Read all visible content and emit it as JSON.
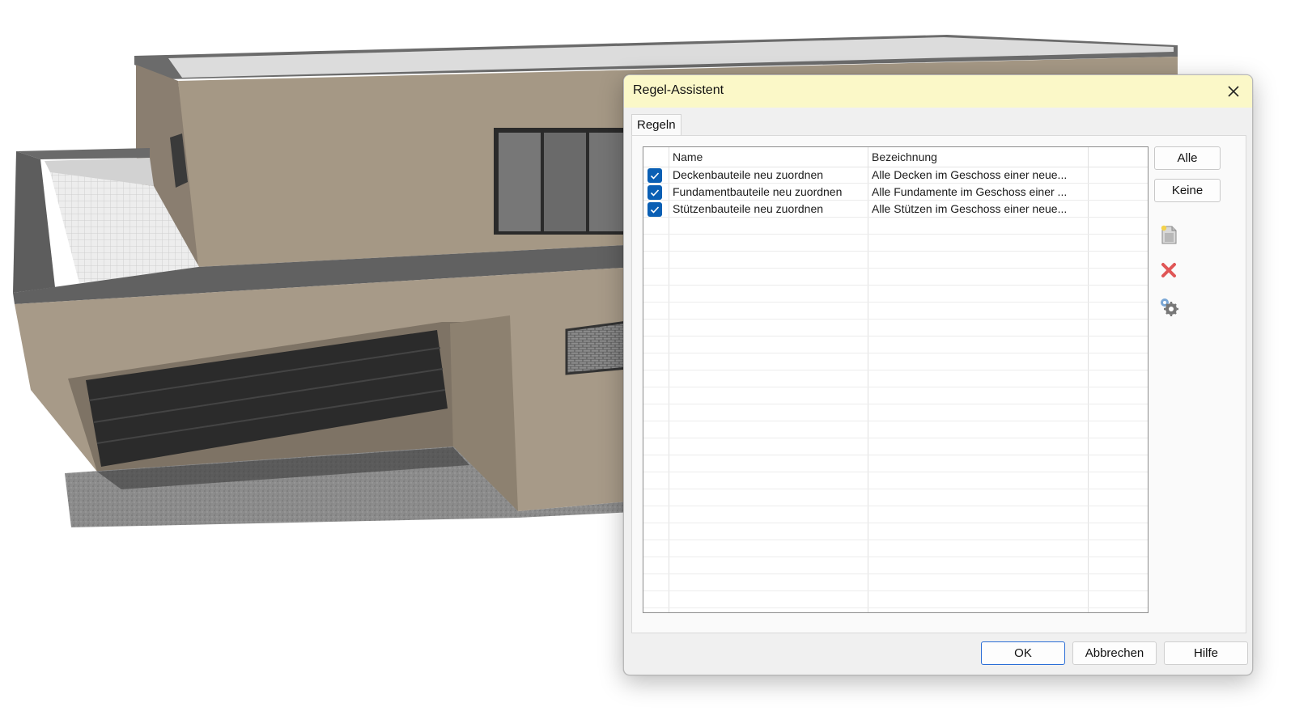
{
  "dialog": {
    "title": "Regel-Assistent",
    "tab_label": "Regeln",
    "columns": {
      "name": "Name",
      "description": "Bezeichnung"
    },
    "rows": [
      {
        "checked": true,
        "name": "Deckenbauteile neu zuordnen",
        "description": "Alle Decken im Geschoss einer neue..."
      },
      {
        "checked": true,
        "name": "Fundamentbauteile neu zuordnen",
        "description": "Alle Fundamente im Geschoss einer ..."
      },
      {
        "checked": true,
        "name": "Stützenbauteile neu zuordnen",
        "description": "Alle Stützen im Geschoss einer neue..."
      }
    ],
    "side_buttons": {
      "all": "Alle",
      "none": "Keine"
    },
    "icon_buttons": [
      "new-rule-icon",
      "delete-rule-icon",
      "settings-gears-icon"
    ],
    "footer": {
      "ok": "OK",
      "cancel": "Abbrechen",
      "help": "Hilfe"
    }
  },
  "colors": {
    "titlebar": "#fbf8c8",
    "checkbox": "#0a5fb4",
    "delete": "#e05656",
    "facade": "#a49684",
    "roof": "#5f5f5f"
  }
}
